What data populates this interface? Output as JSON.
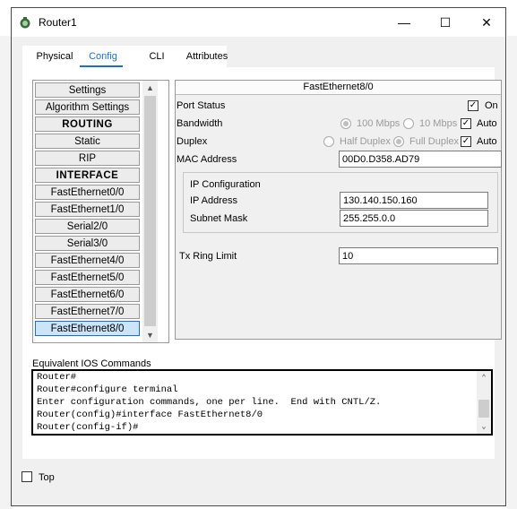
{
  "window": {
    "title": "Router1",
    "controls": {
      "minimize": "—",
      "maximize": "☐",
      "close": "✕"
    }
  },
  "tabs": [
    {
      "label": "Physical",
      "active": false
    },
    {
      "label": "Config",
      "active": true
    },
    {
      "label": "CLI",
      "active": false
    },
    {
      "label": "Attributes",
      "active": false
    }
  ],
  "sidebar": {
    "items": [
      {
        "label": "Settings",
        "type": "item"
      },
      {
        "label": "Algorithm Settings",
        "type": "item"
      },
      {
        "label": "ROUTING",
        "type": "header"
      },
      {
        "label": "Static",
        "type": "item"
      },
      {
        "label": "RIP",
        "type": "item"
      },
      {
        "label": "INTERFACE",
        "type": "header"
      },
      {
        "label": "FastEthernet0/0",
        "type": "item"
      },
      {
        "label": "FastEthernet1/0",
        "type": "item"
      },
      {
        "label": "Serial2/0",
        "type": "item"
      },
      {
        "label": "Serial3/0",
        "type": "item"
      },
      {
        "label": "FastEthernet4/0",
        "type": "item"
      },
      {
        "label": "FastEthernet5/0",
        "type": "item"
      },
      {
        "label": "FastEthernet6/0",
        "type": "item"
      },
      {
        "label": "FastEthernet7/0",
        "type": "item"
      },
      {
        "label": "FastEthernet8/0",
        "type": "item",
        "selected": true
      }
    ]
  },
  "interface": {
    "title": "FastEthernet8/0",
    "port_status": {
      "label": "Port Status",
      "on_label": "On",
      "on_checked": true
    },
    "bandwidth": {
      "label": "Bandwidth",
      "option_100": "100 Mbps",
      "option_10": "10 Mbps",
      "auto_label": "Auto",
      "auto_checked": true
    },
    "duplex": {
      "label": "Duplex",
      "option_half": "Half Duplex",
      "option_full": "Full Duplex",
      "auto_label": "Auto",
      "auto_checked": true
    },
    "mac": {
      "label": "MAC Address",
      "value": "00D0.D358.AD79"
    },
    "ip_config": {
      "title": "IP Configuration",
      "ip_label": "IP Address",
      "ip_value": "130.140.150.160",
      "mask_label": "Subnet Mask",
      "mask_value": "255.255.0.0"
    },
    "tx_ring": {
      "label": "Tx Ring Limit",
      "value": "10"
    }
  },
  "ios": {
    "label": "Equivalent IOS Commands",
    "lines": [
      "Router#",
      "Router#configure terminal",
      "Enter configuration commands, one per line.  End with CNTL/Z.",
      "Router(config)#interface FastEthernet8/0",
      "Router(config-if)#"
    ]
  },
  "footer": {
    "top_label": "Top",
    "top_checked": false
  },
  "colors": {
    "accent": "#1e6dd5"
  }
}
